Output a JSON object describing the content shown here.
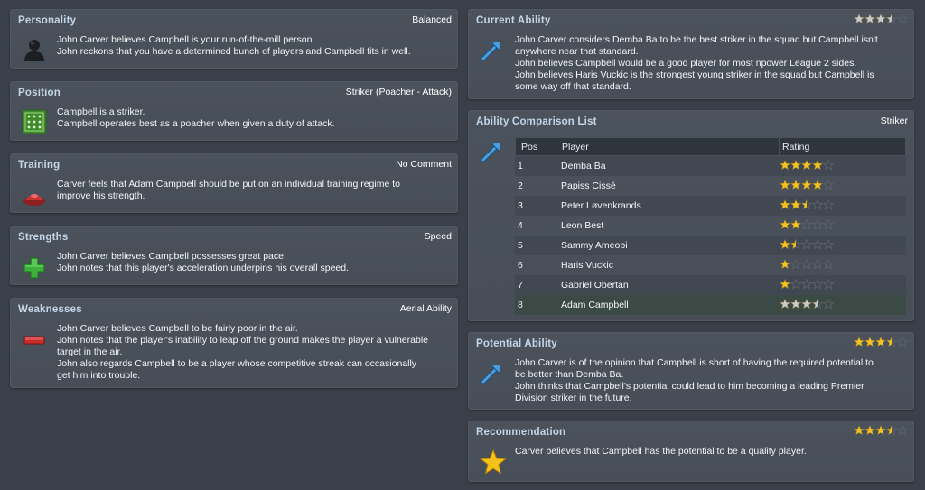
{
  "left": {
    "personality": {
      "title": "Personality",
      "value": "Balanced",
      "lines": [
        "John Carver believes Campbell is your run-of-the-mill person.",
        "John reckons that you have a determined bunch of players and Campbell fits in well."
      ]
    },
    "position": {
      "title": "Position",
      "value": "Striker (Poacher - Attack)",
      "lines": [
        "Campbell is a striker.",
        "Campbell operates best as a poacher when given a duty of attack."
      ]
    },
    "training": {
      "title": "Training",
      "value": "No Comment",
      "lines": [
        "Carver feels that Adam Campbell should be put on an individual training regime to",
        "improve his strength."
      ]
    },
    "strengths": {
      "title": "Strengths",
      "value": "Speed",
      "lines": [
        "John Carver believes Campbell possesses great pace.",
        "John notes that this player's acceleration underpins his overall speed."
      ]
    },
    "weaknesses": {
      "title": "Weaknesses",
      "value": "Aerial Ability",
      "lines": [
        "John Carver believes Campbell to be fairly poor in the air.",
        "John notes that the player's inability to leap off the ground makes the player a vulnerable",
        "target in the air.",
        "John also regards Campbell to be a player whose competitive streak can occasionally",
        "get him into trouble."
      ]
    }
  },
  "right": {
    "current_ability": {
      "title": "Current Ability",
      "rating": 3.5,
      "rating_style": "grey",
      "lines": [
        "John Carver considers Demba Ba to be the best striker in the squad but Campbell isn't",
        "anywhere near that standard.",
        "John believes Campbell would be a good player for most npower League 2 sides.",
        "John believes Haris Vuckic is the strongest young striker in the squad but Campbell is",
        "some way off that standard."
      ]
    },
    "comparison": {
      "title": "Ability Comparison List",
      "value": "Striker",
      "headers": {
        "pos": "Pos",
        "player": "Player",
        "rating": "Rating"
      },
      "rows": [
        {
          "pos": "1",
          "player": "Demba Ba",
          "rating": 4,
          "style": "gold"
        },
        {
          "pos": "2",
          "player": "Papiss Cissé",
          "rating": 4,
          "style": "gold"
        },
        {
          "pos": "3",
          "player": "Peter Løvenkrands",
          "rating": 2.5,
          "style": "gold"
        },
        {
          "pos": "4",
          "player": "Leon Best",
          "rating": 2,
          "style": "gold"
        },
        {
          "pos": "5",
          "player": "Sammy Ameobi",
          "rating": 1.5,
          "style": "gold"
        },
        {
          "pos": "6",
          "player": "Haris Vuckic",
          "rating": 1,
          "style": "gold"
        },
        {
          "pos": "7",
          "player": "Gabriel Obertan",
          "rating": 1,
          "style": "gold"
        },
        {
          "pos": "8",
          "player": "Adam Campbell",
          "rating": 3.5,
          "style": "grey"
        }
      ]
    },
    "potential_ability": {
      "title": "Potential Ability",
      "rating": 3.5,
      "rating_style": "gold",
      "lines": [
        "John Carver is of the opinion that Campbell is short of having the required potential to",
        "be better than Demba Ba.",
        "John thinks that Campbell's potential could lead to him becoming a leading Premier",
        "Division striker in the future."
      ]
    },
    "recommendation": {
      "title": "Recommendation",
      "rating": 3.5,
      "rating_style": "gold",
      "lines": [
        "Carver believes that Campbell has the potential to be a quality player."
      ]
    }
  },
  "icons": {
    "personality": "person-silhouette-icon",
    "position": "pitch-formation-icon",
    "training": "training-cone-icon",
    "strengths": "plus-icon",
    "weaknesses": "minus-icon",
    "current_ability": "arrow-up-right-icon",
    "comparison": "arrow-up-right-icon",
    "potential_ability": "arrow-up-right-icon",
    "recommendation": "star-icon"
  },
  "colors": {
    "star_gold": "#f3c325",
    "star_grey": "#c9cdd2",
    "star_empty": "#5a6069",
    "title": "#c3d6e8"
  }
}
